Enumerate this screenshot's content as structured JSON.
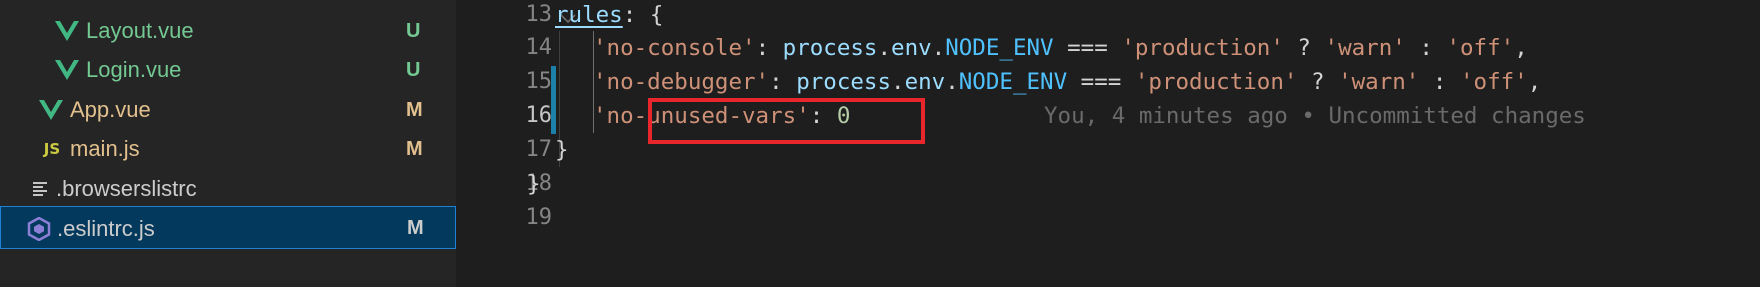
{
  "sidebar": {
    "files": [
      {
        "name": "Layout.vue",
        "status": "U",
        "icon": "vue-icon"
      },
      {
        "name": "Login.vue",
        "status": "U",
        "icon": "vue-icon"
      },
      {
        "name": "App.vue",
        "status": "M",
        "icon": "vue-icon"
      },
      {
        "name": "main.js",
        "status": "M",
        "icon": "js-icon",
        "icon_text": "JS"
      },
      {
        "name": ".browserslistrc",
        "status": "",
        "icon": "list-icon"
      },
      {
        "name": ".eslintrc.js",
        "status": "M",
        "icon": "eslint-icon",
        "selected": true
      }
    ]
  },
  "editor": {
    "line_numbers": [
      "13",
      "14",
      "15",
      "16",
      "17",
      "18",
      "19"
    ],
    "active_line": "16",
    "lines": {
      "l13": {
        "key": "rules",
        "punc": ": {"
      },
      "l14": {
        "key": "'no-console'",
        "sep": ": ",
        "obj": "process",
        "dot1": ".",
        "env": "env",
        "dot2": ".",
        "const": "NODE_ENV",
        "op": " === ",
        "val": "'production'",
        "q": " ? ",
        "warn": "'warn'",
        "colon": " : ",
        "off": "'off'",
        "end": ","
      },
      "l15": {
        "key": "'no-debugger'",
        "sep": ": ",
        "obj": "process",
        "dot1": ".",
        "env": "env",
        "dot2": ".",
        "const": "NODE_ENV",
        "op": " === ",
        "val": "'production'",
        "q": " ? ",
        "warn": "'warn'",
        "colon": " : ",
        "off": "'off'",
        "end": ","
      },
      "l16": {
        "key": "'no-unused-vars'",
        "sep": ": ",
        "num": "0"
      },
      "l17": {
        "punc": "}"
      },
      "l18": {
        "punc": "}"
      }
    },
    "blame": "You, 4 minutes ago • Uncommitted changes"
  },
  "colors": {
    "accent_highlight": "#e8262b",
    "diff_modified": "#1b81a8",
    "vue_green": "#41b883"
  }
}
